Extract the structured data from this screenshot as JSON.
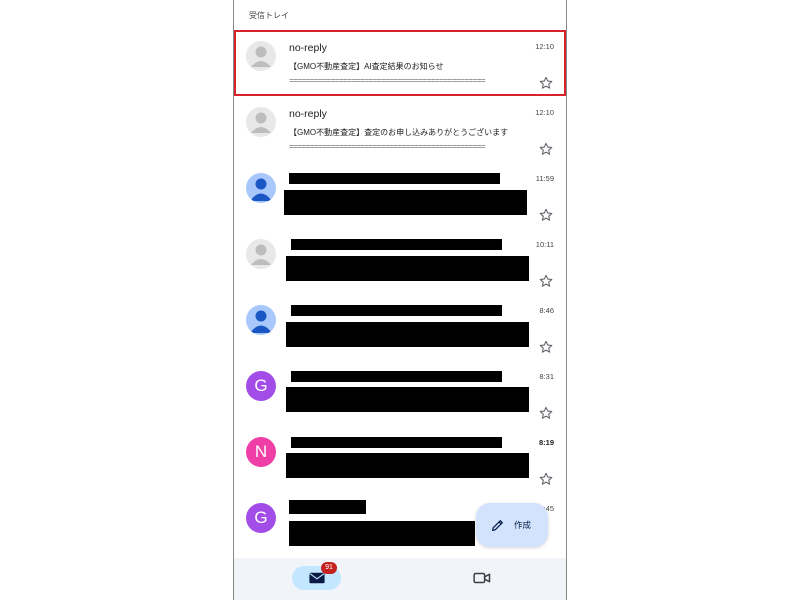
{
  "header": {
    "inbox_label": "受信トレイ"
  },
  "emails": [
    {
      "sender": "no-reply",
      "subject": "【GMO不動産査定】AI査定結果のお知らせ",
      "snippet": "===============================================",
      "time": "12:10",
      "avatar_icon": "person-icon"
    },
    {
      "sender": "no-reply",
      "subject": "【GMO不動産査定】査定のお申し込みありがとうございます",
      "snippet": "===============================================",
      "time": "12:10",
      "avatar_icon": "person-icon"
    },
    {
      "time": "11:59",
      "avatar_icon": "person-icon"
    },
    {
      "time": "10:11",
      "avatar_icon": "person-icon"
    },
    {
      "time": "8:46",
      "avatar_icon": "person-icon"
    },
    {
      "time": "8:31",
      "avatar_letter": "G"
    },
    {
      "time": "8:19",
      "avatar_letter": "N"
    },
    {
      "time": "8:45",
      "avatar_letter": "G"
    }
  ],
  "compose": {
    "label": "作成",
    "icon": "pencil-icon"
  },
  "bottom_nav": {
    "mail_badge": "91",
    "mail_icon": "mail-icon",
    "meet_icon": "video-icon"
  },
  "colors": {
    "highlight": "#d9232a",
    "avatar_grey": "#e8e8e8",
    "avatar_blue": "#a8c7fa",
    "avatar_purple": "#a24de8",
    "avatar_pink": "#ef3fa7",
    "compose_bg": "#d3e3fd",
    "badge": "#c5221f"
  }
}
